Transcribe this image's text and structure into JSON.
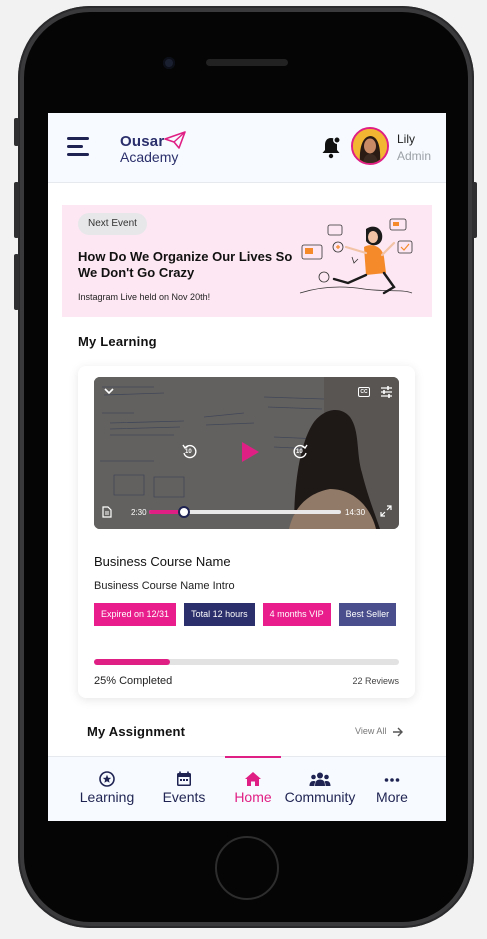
{
  "app": {
    "logo_line1": "Ousar",
    "logo_line2": "Academy"
  },
  "user": {
    "name": "Lily",
    "role": "Admin"
  },
  "event": {
    "tag": "Next Event",
    "title": "How Do We Organize Our Lives So We Don't Go Crazy",
    "subtitle": "Instagram Live held on Nov 20th!"
  },
  "learning": {
    "section_title": "My Learning",
    "course": {
      "name": "Business Course Name",
      "intro": "Business Course Name Intro",
      "tags": [
        {
          "label": "Expired on 12/31",
          "color": "#e91e8c"
        },
        {
          "label": "Total 12 hours",
          "color": "#2b2f6b"
        },
        {
          "label": "4 months VIP",
          "color": "#e91e8c"
        },
        {
          "label": "Best Seller",
          "color": "#4a4e8c"
        }
      ],
      "progress_fraction": 0.25,
      "progress_label": "25% Completed",
      "reviews": "22 Reviews"
    },
    "video": {
      "current_time": "2:30",
      "duration": "14:30",
      "played_fraction": 0.18,
      "skip_back": "10",
      "skip_forward": "10",
      "cc": "CC"
    }
  },
  "assignment": {
    "section_title": "My Assignment",
    "view_all": "View All"
  },
  "nav": {
    "items": [
      {
        "label": "Learning",
        "icon": "star-badge-icon",
        "active": false
      },
      {
        "label": "Events",
        "icon": "calendar-icon",
        "active": false
      },
      {
        "label": "Home",
        "icon": "home-icon",
        "active": true
      },
      {
        "label": "Community",
        "icon": "people-icon",
        "active": false
      },
      {
        "label": "More",
        "icon": "more-dots-icon",
        "active": false
      }
    ]
  },
  "colors": {
    "accent": "#e01f84",
    "navy": "#1f2352",
    "banner_bg": "#fde7f2"
  }
}
